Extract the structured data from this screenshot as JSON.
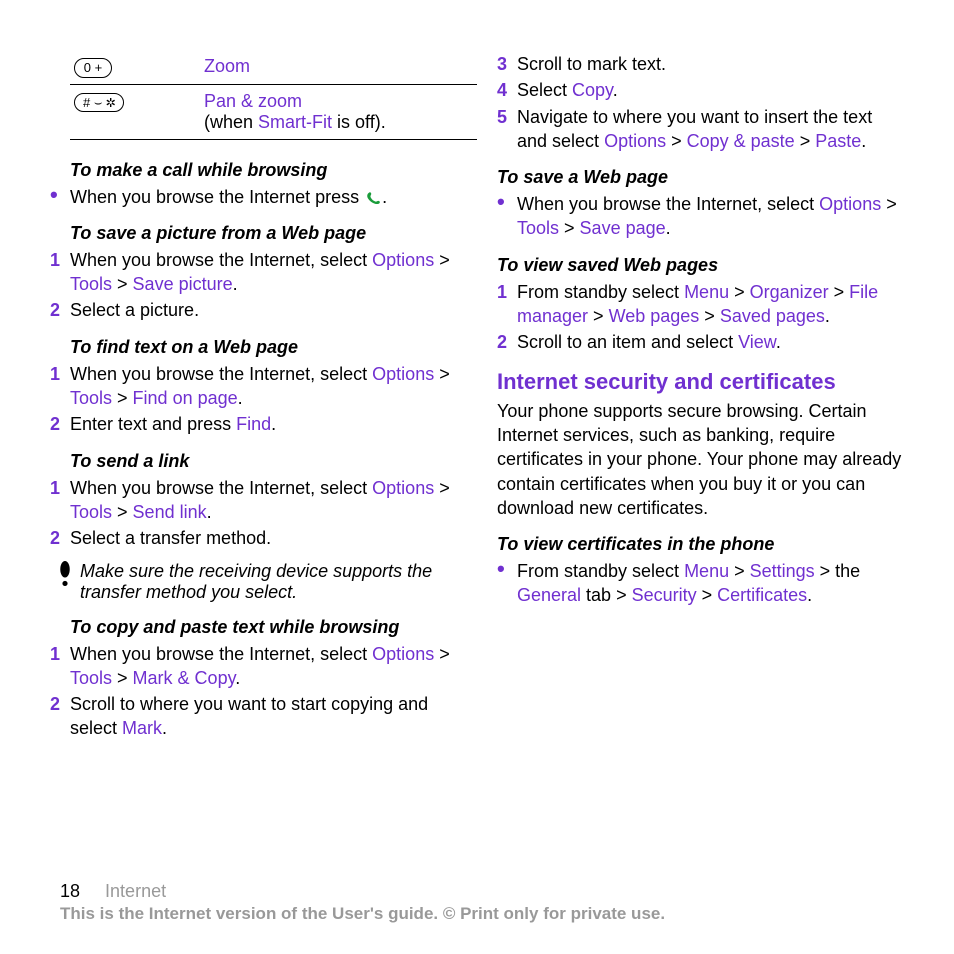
{
  "keytable": [
    {
      "icon": "0 +",
      "line1": {
        "link": "Zoom"
      }
    },
    {
      "icon": "# ⌣ ✲",
      "line1": {
        "link": "Pan & zoom"
      },
      "line2": {
        "pre": "(when ",
        "link": "Smart-Fit",
        "post": " is off)."
      }
    }
  ],
  "col1": {
    "s1": {
      "title": "To make a call while browsing",
      "bullet": {
        "pre": "When you browse the Internet press ",
        "post": "."
      }
    },
    "s2": {
      "title": "To save a picture from a Web page",
      "steps": [
        {
          "pre": "When you browse the Internet, select ",
          "l1": "Options",
          "g1": " > ",
          "l2": "Tools",
          "g2": " > ",
          "l3": "Save picture",
          "post": "."
        },
        {
          "pre": "Select a picture."
        }
      ]
    },
    "s3": {
      "title": "To find text on a Web page",
      "steps": [
        {
          "pre": "When you browse the Internet, select ",
          "l1": "Options",
          "g1": " > ",
          "l2": "Tools",
          "g2": " > ",
          "l3": "Find on page",
          "post": "."
        },
        {
          "pre": "Enter text and press ",
          "l1": "Find",
          "post": "."
        }
      ]
    },
    "s4": {
      "title": "To send a link",
      "steps": [
        {
          "pre": "When you browse the Internet, select ",
          "l1": "Options",
          "g1": " > ",
          "l2": "Tools",
          "g2": " > ",
          "l3": "Send link",
          "post": "."
        },
        {
          "pre": "Select a transfer method."
        }
      ],
      "note": "Make sure the receiving device supports the transfer method you select."
    },
    "s5": {
      "title": "To copy and paste text while browsing",
      "steps": [
        {
          "pre": "When you browse the Internet, select ",
          "l1": "Options",
          "g1": " > ",
          "l2": "Tools",
          "g2": " > ",
          "l3": "Mark & Copy",
          "post": "."
        },
        {
          "pre": "Scroll to where you want to start copying and select ",
          "l1": "Mark",
          "post": "."
        }
      ]
    }
  },
  "col2": {
    "s5cont": [
      {
        "n": "3",
        "pre": "Scroll to mark text."
      },
      {
        "n": "4",
        "pre": "Select ",
        "l1": "Copy",
        "post": "."
      },
      {
        "n": "5",
        "pre": "Navigate to where you want to insert the text and select ",
        "l1": "Options",
        "g1": " > ",
        "l2": "Copy & paste",
        "g2": " > ",
        "l3": "Paste",
        "post": "."
      }
    ],
    "s6": {
      "title": "To save a Web page",
      "bullet": {
        "pre": "When you browse the Internet, select ",
        "l1": "Options",
        "g1": " > ",
        "l2": "Tools",
        "g2": " > ",
        "l3": "Save page",
        "post": "."
      }
    },
    "s7": {
      "title": "To view saved Web pages",
      "steps": [
        {
          "pre": "From standby select ",
          "l1": "Menu",
          "g1": " > ",
          "l2": "Organizer",
          "g2": " > ",
          "l3": "File manager",
          "g3": " > ",
          "l4": "Web pages",
          "g4": " > ",
          "l5": "Saved pages",
          "post": "."
        },
        {
          "pre": "Scroll to an item and select ",
          "l1": "View",
          "post": "."
        }
      ]
    },
    "h2": "Internet security and certificates",
    "para": "Your phone supports secure browsing. Certain Internet services, such as banking, require certificates in your phone. Your phone may already contain certificates when you buy it or you can download new certificates.",
    "s8": {
      "title": "To view certificates in the phone",
      "bullet": {
        "pre": "From standby select ",
        "l1": "Menu",
        "g1": " > ",
        "l2": "Settings",
        "g2": " > the ",
        "l3": "General",
        "g3": " tab > ",
        "l4": "Security",
        "g4": " > ",
        "l5": "Certificates",
        "post": "."
      }
    }
  },
  "footer": {
    "page": "18",
    "chapter": "Internet",
    "note": "This is the Internet version of the User's guide. © Print only for private use."
  }
}
